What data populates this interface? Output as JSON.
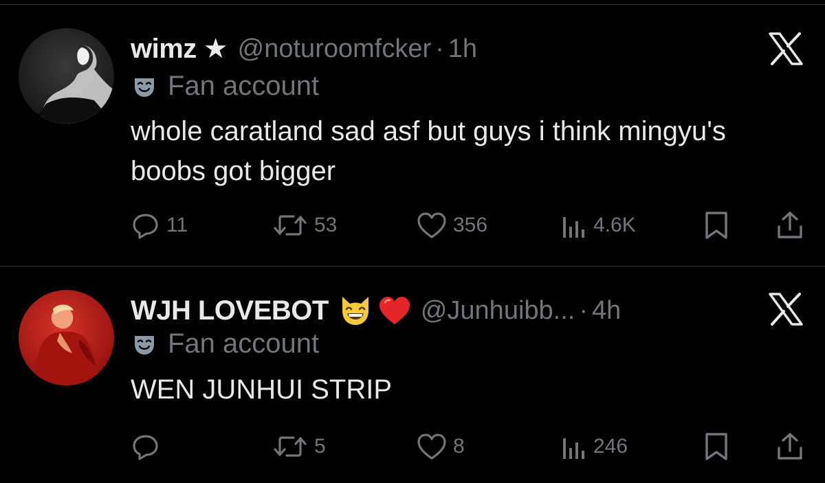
{
  "tweets": [
    {
      "display_name": "wimz",
      "name_badge": "★",
      "handle": "@noturoomfcker",
      "separator": "·",
      "time": "1h",
      "label": "Fan account",
      "text": "whole caratland sad asf but guys i think mingyu's boobs got bigger",
      "replies": "11",
      "reposts": "53",
      "likes": "356",
      "views": "4.6K",
      "avatar_icon": "grayscale-portrait-avatar",
      "name_emojis": []
    },
    {
      "display_name": "WJH LOVEBOT",
      "handle": "@Junhuibb...",
      "separator": "·",
      "time": "4h",
      "label": "Fan account",
      "text": "WEN JUNHUI STRIP",
      "replies": "",
      "reposts": "5",
      "likes": "8",
      "views": "246",
      "avatar_icon": "red-portrait-avatar",
      "name_emojis": [
        "grinning-cat-emoji",
        "red-heart-emoji"
      ]
    }
  ],
  "colors": {
    "background": "#000000",
    "primary_text": "#e7e9ea",
    "secondary_text": "#71767b",
    "divider": "#2f3336",
    "label_icon": "#8b98a5"
  },
  "icons": {
    "more": "x-logo-icon",
    "label": "fan-account-mask-icon",
    "reply": "reply-bubble-icon",
    "repost": "repost-arrows-icon",
    "like": "heart-outline-icon",
    "views": "views-bar-chart-icon",
    "bookmark": "bookmark-icon",
    "share": "share-upload-icon"
  }
}
